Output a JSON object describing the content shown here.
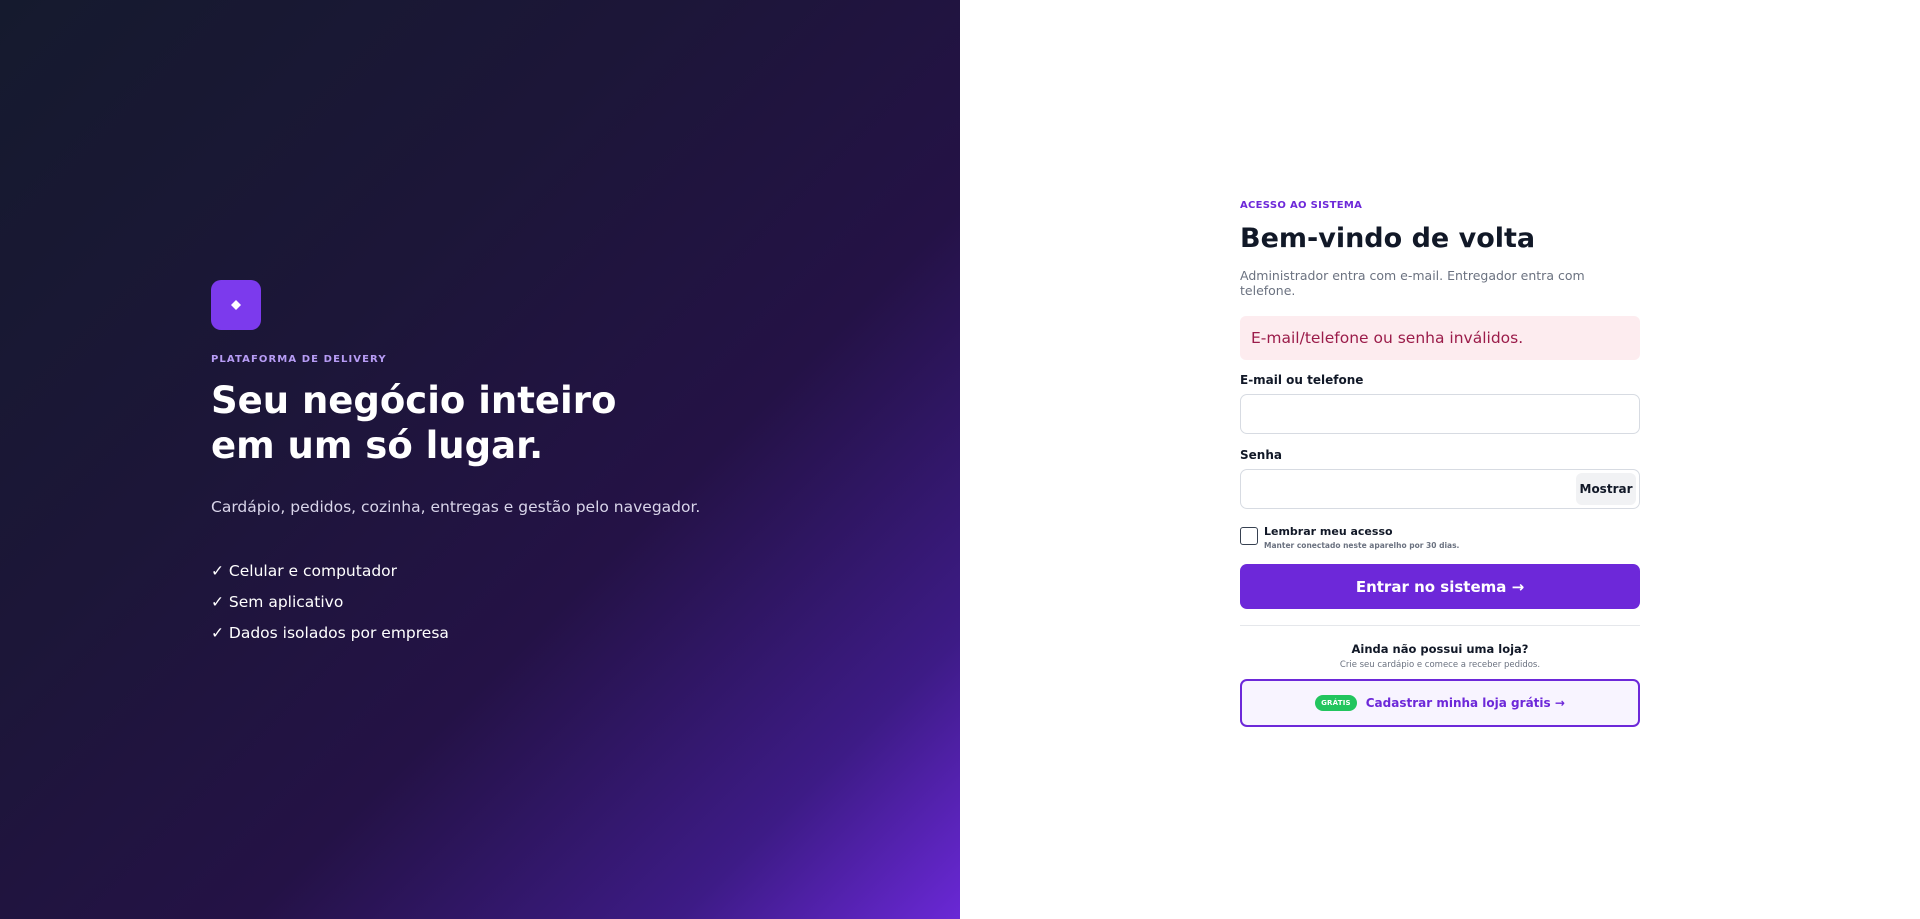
{
  "hero": {
    "logo_icon": "diamond-icon",
    "eyebrow": "PLATAFORMA DE DELIVERY",
    "title": "Seu negócio inteiro em um só lugar.",
    "subtitle": "Cardápio, pedidos, cozinha, entregas e gestão pelo navegador.",
    "features": [
      "✓ Celular e computador",
      "✓ Sem aplicativo",
      "✓ Dados isolados por empresa"
    ]
  },
  "login": {
    "eyebrow": "ACESSO AO SISTEMA",
    "title": "Bem-vindo de volta",
    "subtitle": "Administrador entra com e-mail. Entregador entra com telefone.",
    "error": "E-mail/telefone ou senha inválidos.",
    "email_label": "E-mail ou telefone",
    "email_value": "",
    "password_label": "Senha",
    "password_value": "",
    "show_label": "Mostrar",
    "remember_label": "Lembrar meu acesso",
    "remember_hint": "Manter conectado neste aparelho por 30 dias.",
    "remember_checked": false,
    "submit_label": "Entrar no sistema →",
    "signup_question": "Ainda não possui uma loja?",
    "signup_hint": "Crie seu cardápio e comece a receber pedidos.",
    "signup_badge": "GRÁTIS",
    "signup_label": "Cadastrar minha loja grátis →"
  },
  "colors": {
    "accent": "#6d28d9",
    "logo": "#7c3aed",
    "badge": "#22c55e",
    "error_bg": "#fdecef",
    "error_text": "#9b1c4a"
  }
}
